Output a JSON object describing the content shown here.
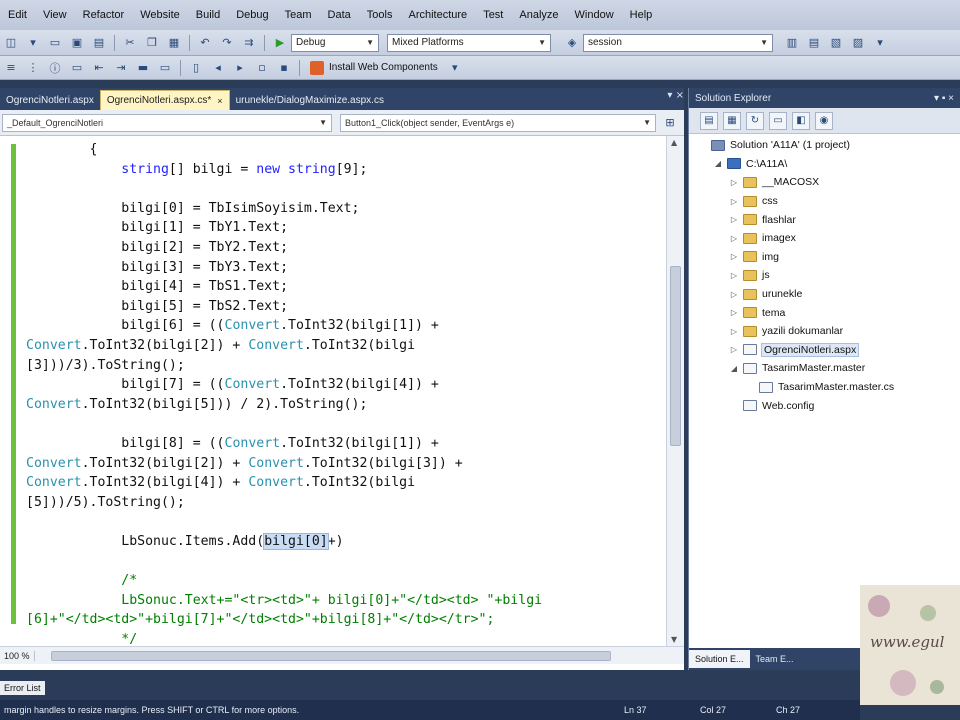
{
  "menu": [
    "Edit",
    "View",
    "Refactor",
    "Website",
    "Build",
    "Debug",
    "Team",
    "Data",
    "Tools",
    "Architecture",
    "Test",
    "Analyze",
    "Window",
    "Help"
  ],
  "toolbar": {
    "config_combo": "Debug",
    "platform_combo": "Mixed Platforms",
    "search_combo": "session",
    "install_label": "Install Web Components"
  },
  "doc_tabs": [
    {
      "label": "OgrenciNotleri.aspx",
      "active": false
    },
    {
      "label": "OgrenciNotleri.aspx.cs*",
      "active": true
    },
    {
      "label": "urunekle/DialogMaximize.aspx.cs",
      "active": false
    }
  ],
  "editor": {
    "class_combo": "_Default_OgrenciNotleri",
    "member_combo": "Button1_Click(object sender, EventArgs e)",
    "zoom": "100 %",
    "code_lines": [
      [
        {
          "t": "        {"
        }
      ],
      [
        {
          "t": "            "
        },
        {
          "t": "string",
          "c": "kw"
        },
        {
          "t": "[] bilgi = "
        },
        {
          "t": "new",
          "c": "kw"
        },
        {
          "t": " "
        },
        {
          "t": "string",
          "c": "kw"
        },
        {
          "t": "[9];"
        }
      ],
      [
        {
          "t": ""
        }
      ],
      [
        {
          "t": "            bilgi[0] = TbIsimSoyisim.Text;"
        }
      ],
      [
        {
          "t": "            bilgi[1] = TbY1.Text;"
        }
      ],
      [
        {
          "t": "            bilgi[2] = TbY2.Text;"
        }
      ],
      [
        {
          "t": "            bilgi[3] = TbY3.Text;"
        }
      ],
      [
        {
          "t": "            bilgi[4] = TbS1.Text;"
        }
      ],
      [
        {
          "t": "            bilgi[5] = TbS2.Text;"
        }
      ],
      [
        {
          "t": "            bilgi[6] = (("
        },
        {
          "t": "Convert",
          "c": "ty"
        },
        {
          "t": ".ToInt32(bilgi[1]) +"
        }
      ],
      [
        {
          "t": "Convert",
          "c": "ty"
        },
        {
          "t": ".ToInt32(bilgi[2]) + "
        },
        {
          "t": "Convert",
          "c": "ty"
        },
        {
          "t": ".ToInt32(bilgi"
        }
      ],
      [
        {
          "t": "[3]))/3).ToString();"
        }
      ],
      [
        {
          "t": "            bilgi[7] = (("
        },
        {
          "t": "Convert",
          "c": "ty"
        },
        {
          "t": ".ToInt32(bilgi[4]) +"
        }
      ],
      [
        {
          "t": "Convert",
          "c": "ty"
        },
        {
          "t": ".ToInt32(bilgi[5])) / 2).ToString();"
        }
      ],
      [
        {
          "t": ""
        }
      ],
      [
        {
          "t": "            bilgi[8] = (("
        },
        {
          "t": "Convert",
          "c": "ty"
        },
        {
          "t": ".ToInt32(bilgi[1]) +"
        }
      ],
      [
        {
          "t": "Convert",
          "c": "ty"
        },
        {
          "t": ".ToInt32(bilgi[2]) + "
        },
        {
          "t": "Convert",
          "c": "ty"
        },
        {
          "t": ".ToInt32(bilgi[3]) +"
        }
      ],
      [
        {
          "t": "Convert",
          "c": "ty"
        },
        {
          "t": ".ToInt32(bilgi[4]) + "
        },
        {
          "t": "Convert",
          "c": "ty"
        },
        {
          "t": ".ToInt32(bilgi"
        }
      ],
      [
        {
          "t": "[5]))/5).ToString();"
        }
      ],
      [
        {
          "t": ""
        }
      ],
      [
        {
          "t": "            LbSonuc.Items.Add("
        },
        {
          "t": "bilgi[0]",
          "c": "hl"
        },
        {
          "t": "+)"
        }
      ],
      [
        {
          "t": ""
        }
      ],
      [
        {
          "t": "            /*",
          "c": "cm"
        }
      ],
      [
        {
          "t": "            LbSonuc.Text+=\"<tr><td>\"+ bilgi[0]+\"</td><td> \"+bilgi",
          "c": "cm"
        }
      ],
      [
        {
          "t": "[6]+\"</td><td>\"+bilgi[7]+\"</td><td>\"+bilgi[8]+\"</td></tr>\";",
          "c": "cm"
        }
      ],
      [
        {
          "t": "            */",
          "c": "cm"
        }
      ]
    ]
  },
  "solution_explorer": {
    "title": "Solution Explorer",
    "pin": "▾ ▪ ×",
    "nodes": [
      {
        "label": "Solution 'A11A' (1 project)",
        "icon": "sol",
        "depth": 0,
        "exp": ""
      },
      {
        "label": "C:\\A11A\\",
        "icon": "proj",
        "depth": 1,
        "exp": "◢"
      },
      {
        "label": "__MACOSX",
        "icon": "folder",
        "depth": 2,
        "exp": "▷"
      },
      {
        "label": "css",
        "icon": "folder",
        "depth": 2,
        "exp": "▷"
      },
      {
        "label": "flashlar",
        "icon": "folder",
        "depth": 2,
        "exp": "▷"
      },
      {
        "label": "imagex",
        "icon": "folder",
        "depth": 2,
        "exp": "▷"
      },
      {
        "label": "img",
        "icon": "folder",
        "depth": 2,
        "exp": "▷"
      },
      {
        "label": "js",
        "icon": "folder",
        "depth": 2,
        "exp": "▷"
      },
      {
        "label": "urunekle",
        "icon": "folder",
        "depth": 2,
        "exp": "▷"
      },
      {
        "label": "tema",
        "icon": "folder",
        "depth": 2,
        "exp": "▷"
      },
      {
        "label": "yazili dokumanlar",
        "icon": "folder",
        "depth": 2,
        "exp": "▷"
      },
      {
        "label": "OgrenciNotleri.aspx",
        "icon": "file",
        "depth": 2,
        "exp": "▷",
        "sel": true
      },
      {
        "label": "TasarimMaster.master",
        "icon": "file",
        "depth": 2,
        "exp": "◢"
      },
      {
        "label": "TasarimMaster.master.cs",
        "icon": "file",
        "depth": 3,
        "exp": ""
      },
      {
        "label": "Web.config",
        "icon": "file",
        "depth": 2,
        "exp": ""
      }
    ],
    "bottom_tabs": [
      {
        "label": "Solution E...",
        "active": true
      },
      {
        "label": "Team E...",
        "active": false
      }
    ]
  },
  "watermark": "www.egul",
  "error_list_tab": "Error List",
  "status": {
    "message": "margin handles to resize margins. Press SHIFT or CTRL for more options.",
    "ln": "Ln 37",
    "col": "Col 27",
    "ch": "Ch 27"
  }
}
